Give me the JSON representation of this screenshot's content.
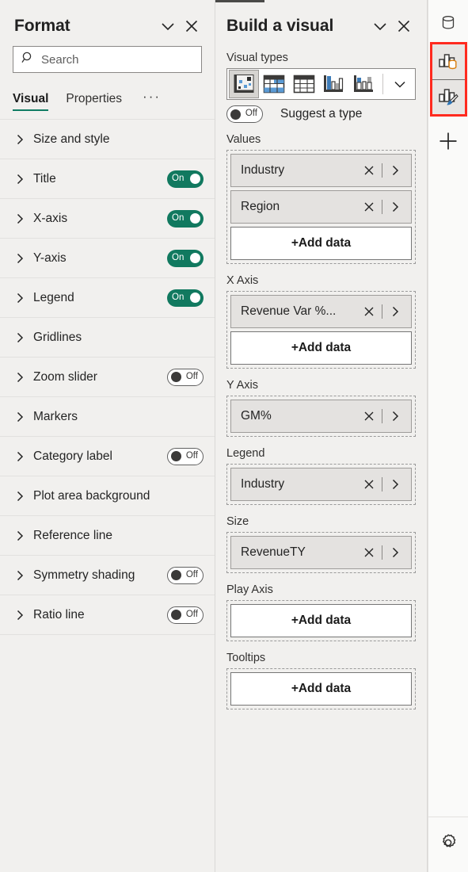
{
  "format_panel": {
    "title": "Format",
    "collapse_icon": "chevron-down-icon",
    "close_icon": "close-icon",
    "search": {
      "placeholder": "Search",
      "value": "",
      "icon": "search-icon"
    },
    "tabs": [
      {
        "label": "Visual",
        "active": true
      },
      {
        "label": "Properties",
        "active": false
      }
    ],
    "overflow_label": "···",
    "accent_color": "#107C63",
    "toggle_on_color": "#11795F",
    "rows": [
      {
        "label": "Size and style",
        "toggle": null
      },
      {
        "label": "Title",
        "toggle": "On"
      },
      {
        "label": "X-axis",
        "toggle": "On"
      },
      {
        "label": "Y-axis",
        "toggle": "On"
      },
      {
        "label": "Legend",
        "toggle": "On"
      },
      {
        "label": "Gridlines",
        "toggle": null
      },
      {
        "label": "Zoom slider",
        "toggle": "Off"
      },
      {
        "label": "Markers",
        "toggle": null
      },
      {
        "label": "Category label",
        "toggle": "Off"
      },
      {
        "label": "Plot area background",
        "toggle": null
      },
      {
        "label": "Reference line",
        "toggle": null
      },
      {
        "label": "Symmetry shading",
        "toggle": "Off"
      },
      {
        "label": "Ratio line",
        "toggle": "Off"
      }
    ]
  },
  "build_panel": {
    "title": "Build a visual",
    "collapse_icon": "chevron-down-icon",
    "close_icon": "close-icon",
    "visual_types_label": "Visual types",
    "visual_types": [
      {
        "name": "scatter-chart-icon",
        "selected": true
      },
      {
        "name": "matrix-icon",
        "selected": false
      },
      {
        "name": "table-icon",
        "selected": false
      },
      {
        "name": "clustered-column-chart-icon",
        "selected": false
      },
      {
        "name": "stacked-column-chart-icon",
        "selected": false
      }
    ],
    "visual_types_more_icon": "chevron-down-icon",
    "suggest": {
      "toggle": "Off",
      "label": "Suggest a type"
    },
    "add_data_label": "+Add data",
    "wells": [
      {
        "label": "Values",
        "fields": [
          "Industry",
          "Region"
        ],
        "add_data": true
      },
      {
        "label": "X Axis",
        "fields": [
          "Revenue Var %..."
        ],
        "add_data": true
      },
      {
        "label": "Y Axis",
        "fields": [
          "GM%"
        ],
        "add_data": false
      },
      {
        "label": "Legend",
        "fields": [
          "Industry"
        ],
        "add_data": false
      },
      {
        "label": "Size",
        "fields": [
          "RevenueTY"
        ],
        "add_data": false
      },
      {
        "label": "Play Axis",
        "fields": [],
        "add_data": true
      },
      {
        "label": "Tooltips",
        "fields": [],
        "add_data": true
      }
    ]
  },
  "rail": {
    "highlight_color": "#FF2A1F",
    "items": [
      {
        "name": "data-pane-icon",
        "highlighted": false
      },
      {
        "name": "build-visual-icon",
        "highlighted": true
      },
      {
        "name": "format-visual-icon",
        "highlighted": true
      },
      {
        "name": "add-pane-icon",
        "highlighted": false
      }
    ],
    "settings_icon": "gear-icon"
  }
}
